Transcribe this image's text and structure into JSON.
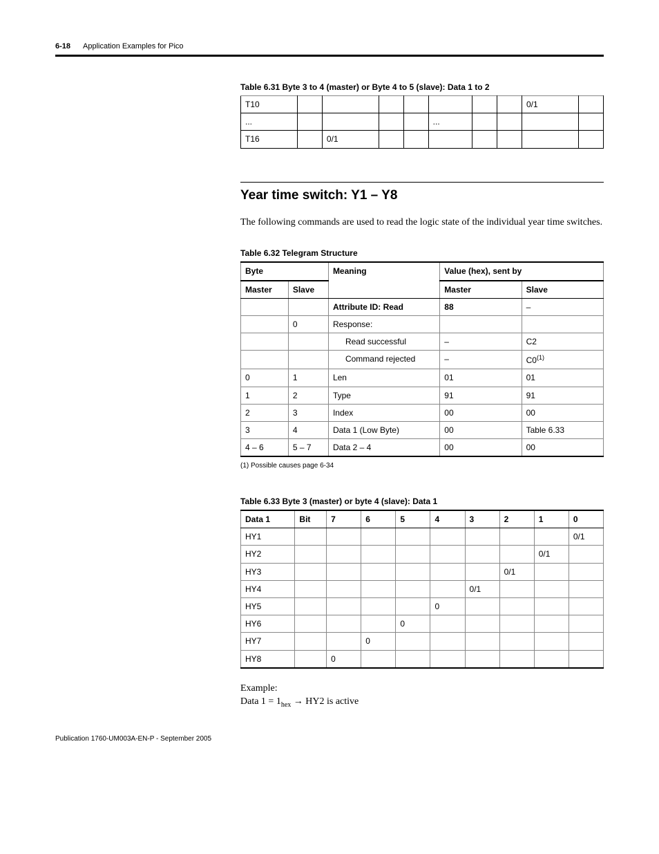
{
  "header": {
    "page_num": "6-18",
    "section": "Application Examples for Pico"
  },
  "table631": {
    "caption": "Table 6.31 Byte 3 to 4 (master) or Byte 4 to 5 (slave):  Data 1 to 2",
    "rows": [
      {
        "c0": "T10",
        "c1": "",
        "c2": "",
        "c3": "",
        "c4": "",
        "c5": "",
        "c6": "",
        "c7": "",
        "c8": "0/1",
        "c9": ""
      },
      {
        "c0": "...",
        "c1": "",
        "c2": "",
        "c3": "",
        "c4": "",
        "c5": "...",
        "c6": "",
        "c7": "",
        "c8": "",
        "c9": ""
      },
      {
        "c0": "T16",
        "c1": "",
        "c2": "0/1",
        "c3": "",
        "c4": "",
        "c5": "",
        "c6": "",
        "c7": "",
        "c8": "",
        "c9": ""
      }
    ]
  },
  "section": {
    "title": "Year time switch: Y1 – Y8",
    "intro": "The following commands are used to read the logic state of the individual year time switches."
  },
  "table632": {
    "caption": "Table 6.32 Telegram Structure",
    "head": {
      "byte": "Byte",
      "meaning": "Meaning",
      "value": "Value (hex), sent by",
      "master": "Master",
      "slave": "Slave"
    },
    "rows": [
      {
        "m": "",
        "s": "",
        "meaning": "Attribute ID: Read",
        "meaning_bold": true,
        "indent": false,
        "vm": "88",
        "vs": "–"
      },
      {
        "m": "",
        "s": "0",
        "meaning": "Response:",
        "meaning_bold": false,
        "indent": false,
        "vm": "",
        "vs": ""
      },
      {
        "m": "",
        "s": "",
        "meaning": "Read successful",
        "meaning_bold": false,
        "indent": true,
        "vm": "–",
        "vs": "C2"
      },
      {
        "m": "",
        "s": "",
        "meaning": "Command rejected",
        "meaning_bold": false,
        "indent": true,
        "vm": "–",
        "vs": "C0",
        "vs_sup": "(1)"
      },
      {
        "m": "0",
        "s": "1",
        "meaning": "Len",
        "meaning_bold": false,
        "indent": false,
        "vm": "01",
        "vs": "01"
      },
      {
        "m": "1",
        "s": "2",
        "meaning": "Type",
        "meaning_bold": false,
        "indent": false,
        "vm": "91",
        "vs": "91"
      },
      {
        "m": "2",
        "s": "3",
        "meaning": "Index",
        "meaning_bold": false,
        "indent": false,
        "vm": "00",
        "vs": "00"
      },
      {
        "m": "3",
        "s": "4",
        "meaning": "Data 1 (Low Byte)",
        "meaning_bold": false,
        "indent": false,
        "vm": "00",
        "vs": "Table 6.33"
      },
      {
        "m": "4 – 6",
        "s": "5 – 7",
        "meaning": "Data 2 – 4",
        "meaning_bold": false,
        "indent": false,
        "vm": "00",
        "vs": "00"
      }
    ],
    "footnote": "(1)   Possible causes page 6-34"
  },
  "table633": {
    "caption": "Table 6.33 Byte 3 (master) or byte 4 (slave): Data 1",
    "head": {
      "d1": "Data 1",
      "bit": "Bit",
      "b7": "7",
      "b6": "6",
      "b5": "5",
      "b4": "4",
      "b3": "3",
      "b2": "2",
      "b1": "1",
      "b0": "0"
    },
    "rows": [
      {
        "d1": "HY1",
        "bit": "",
        "b7": "",
        "b6": "",
        "b5": "",
        "b4": "",
        "b3": "",
        "b2": "",
        "b1": "",
        "b0": "0/1"
      },
      {
        "d1": "HY2",
        "bit": "",
        "b7": "",
        "b6": "",
        "b5": "",
        "b4": "",
        "b3": "",
        "b2": "",
        "b1": "0/1",
        "b0": ""
      },
      {
        "d1": "HY3",
        "bit": "",
        "b7": "",
        "b6": "",
        "b5": "",
        "b4": "",
        "b3": "",
        "b2": "0/1",
        "b1": "",
        "b0": ""
      },
      {
        "d1": "HY4",
        "bit": "",
        "b7": "",
        "b6": "",
        "b5": "",
        "b4": "",
        "b3": "0/1",
        "b2": "",
        "b1": "",
        "b0": ""
      },
      {
        "d1": "HY5",
        "bit": "",
        "b7": "",
        "b6": "",
        "b5": "",
        "b4": "0",
        "b3": "",
        "b2": "",
        "b1": "",
        "b0": ""
      },
      {
        "d1": "HY6",
        "bit": "",
        "b7": "",
        "b6": "",
        "b5": "0",
        "b4": "",
        "b3": "",
        "b2": "",
        "b1": "",
        "b0": ""
      },
      {
        "d1": "HY7",
        "bit": "",
        "b7": "",
        "b6": "0",
        "b5": "",
        "b4": "",
        "b3": "",
        "b2": "",
        "b1": "",
        "b0": ""
      },
      {
        "d1": "HY8",
        "bit": "",
        "b7": "0",
        "b6": "",
        "b5": "",
        "b4": "",
        "b3": "",
        "b2": "",
        "b1": "",
        "b0": ""
      }
    ]
  },
  "example": {
    "l1": "Example:",
    "l2a": "Data 1 = 1",
    "l2sub": "hex",
    "l2b": " → HY2 is active"
  },
  "footer": {
    "pub": "Publication 1760-UM003A-EN-P - September 2005"
  }
}
